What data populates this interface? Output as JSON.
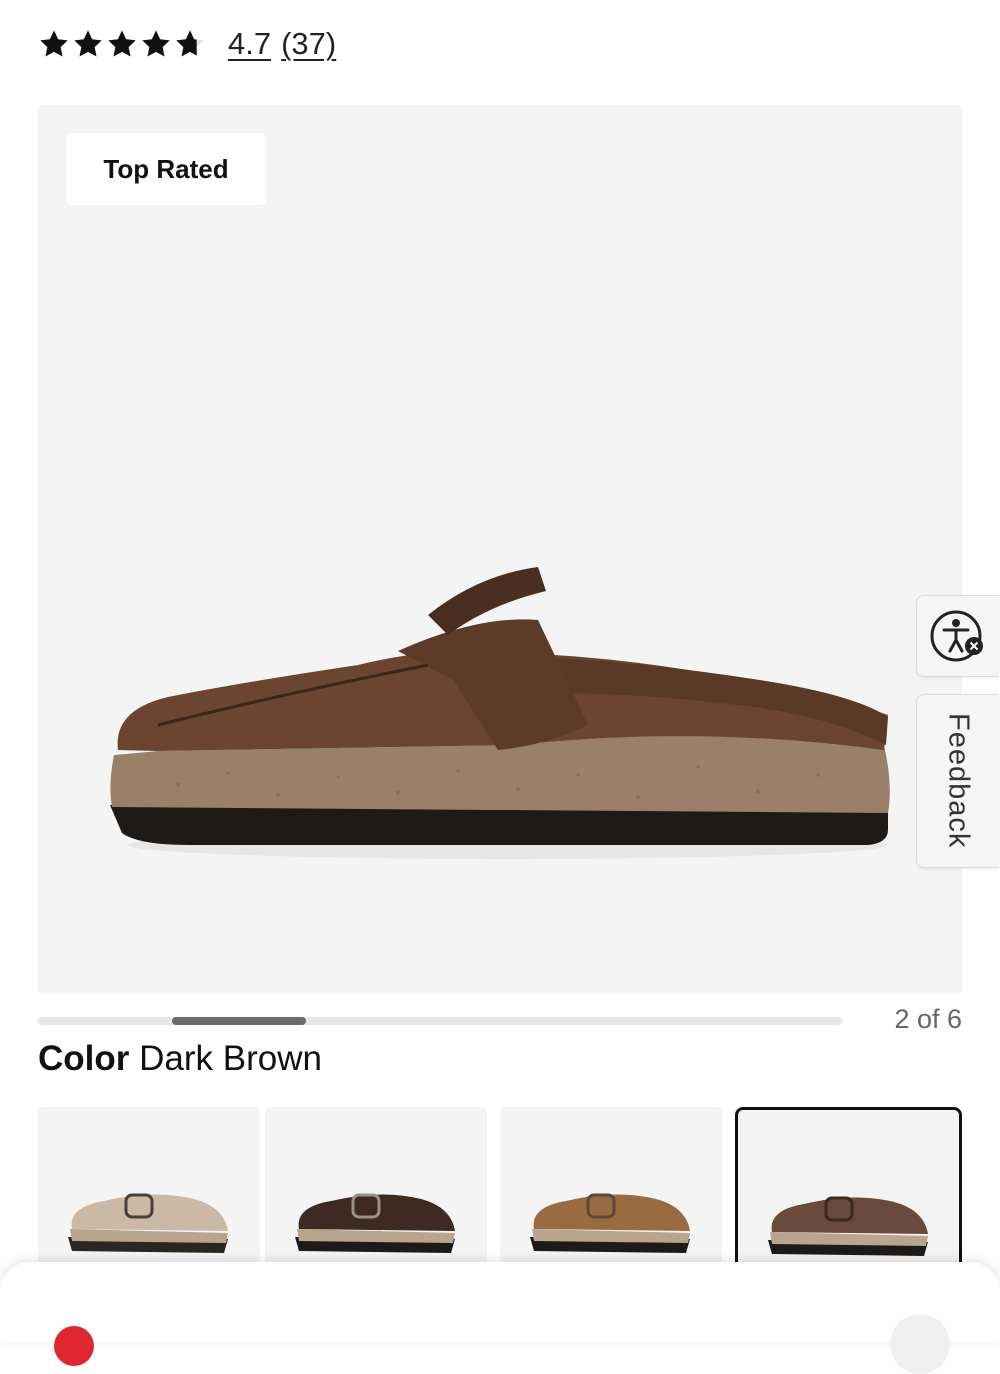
{
  "rating": {
    "value": "4.7",
    "count": "(37)",
    "stars": 4.7,
    "max_stars": 5
  },
  "hero": {
    "badge": "Top Rated",
    "shoe_color": "#6b4530"
  },
  "widgets": {
    "accessibility_icon": "accessibility-icon",
    "feedback_label": "Feedback"
  },
  "gallery": {
    "current": 2,
    "total": 6,
    "counter": "2 of 6"
  },
  "color": {
    "label": "Color",
    "value": "Dark Brown"
  },
  "swatches": [
    {
      "color": "#cbb9a6",
      "selected": false
    },
    {
      "color": "#3e2a22",
      "selected": false
    },
    {
      "color": "#9a6b40",
      "selected": false
    },
    {
      "color": "#6a4a3c",
      "selected": true
    }
  ],
  "colors": {
    "accent_red": "#e0262f",
    "progress_fill": "#6b6b6b",
    "progress_track": "#e6e6e6"
  }
}
